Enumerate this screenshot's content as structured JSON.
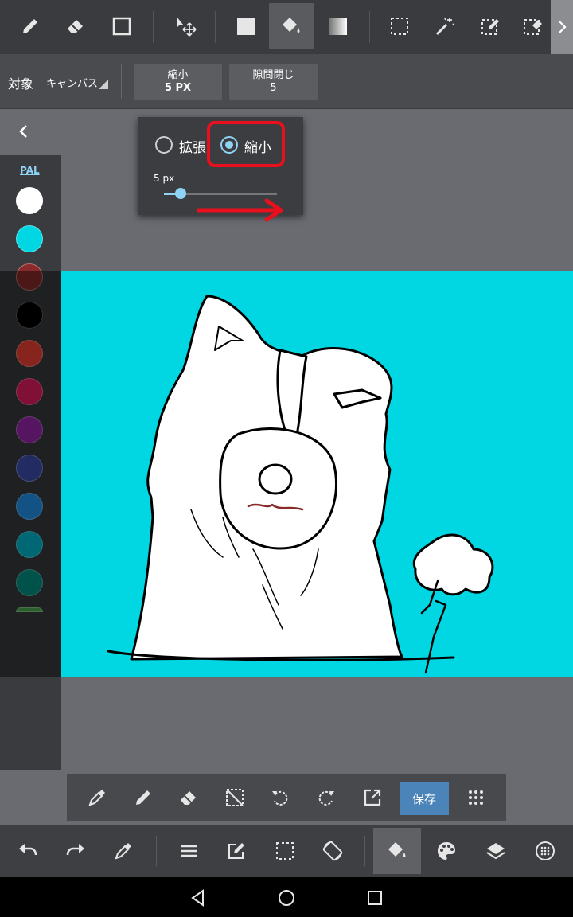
{
  "top_toolbar": {
    "tools": [
      "brush-icon",
      "eraser-icon",
      "rectangle-icon",
      "move-icon",
      "fill-rect-icon",
      "bucket-icon",
      "gradient-icon",
      "select-rect-icon",
      "magic-wand-icon",
      "select-pen-icon",
      "select-eraser-icon"
    ],
    "active_tool": "bucket-icon",
    "more_icon": "chevron-right-icon"
  },
  "option_bar": {
    "target_label": "対象",
    "target_value": "キャンバス",
    "shrink_button": {
      "label": "縮小",
      "value": "5 PX"
    },
    "gap_button": {
      "label": "隙間閉じ",
      "value": "5"
    }
  },
  "collapse_icon": "chevron-left-icon",
  "popup": {
    "expand_label": "拡張",
    "shrink_label": "縮小",
    "selected": "shrink",
    "size_label": "5 px",
    "slider_level": 0.15,
    "highlight_color": "#e8101c"
  },
  "palette": {
    "tab_label": "PAL",
    "colors": [
      "#ffffff",
      "#00d7e3",
      "#8b2a2a",
      "#000000",
      "#f44336",
      "#e91e63",
      "#9c27b0",
      "#3f51b5",
      "#2196f3",
      "#00bcd4",
      "#009688"
    ]
  },
  "canvas": {
    "background": "#00d7e3"
  },
  "float_toolbar": {
    "icons": [
      "eyedropper-icon",
      "pen-icon",
      "eraser-icon",
      "deselect-icon",
      "rotate-left-icon",
      "rotate-right-icon",
      "export-icon",
      "grid-icon"
    ],
    "save_label": "保存"
  },
  "bottom_toolbar": {
    "icons": [
      "undo-icon",
      "redo-icon",
      "eyedropper-icon",
      "menu-icon",
      "edit-icon",
      "selection-icon",
      "rotate-canvas-icon",
      "bucket-icon",
      "palette-icon",
      "layers-icon",
      "more-icon"
    ],
    "active": "bucket-icon"
  },
  "nav": {
    "icons": [
      "back-icon",
      "home-icon",
      "recents-icon"
    ]
  }
}
